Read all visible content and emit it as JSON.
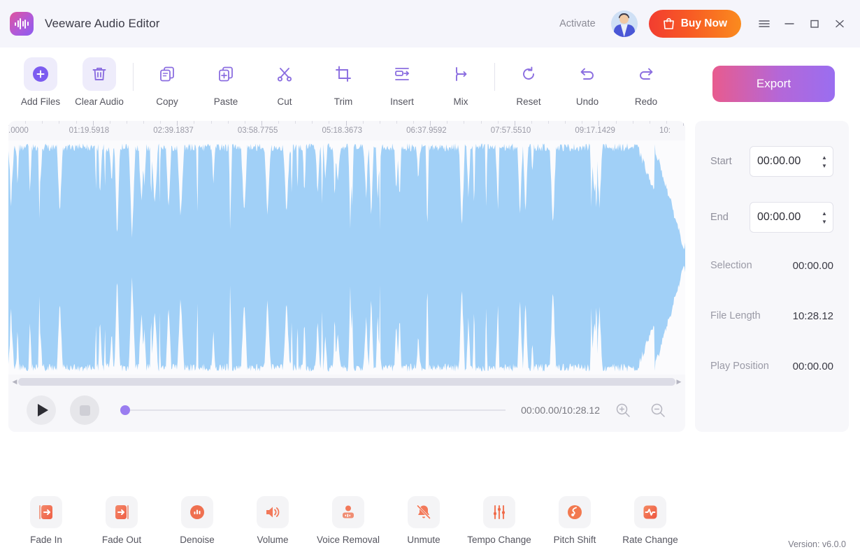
{
  "window": {
    "app_title": "Veeware Audio Editor",
    "logo_icon": "waveform-logo-icon",
    "activate_label": "Activate",
    "avatar_icon": "user-avatar",
    "buy_now_label": "Buy Now",
    "buy_now_icon": "shopping-bag-icon",
    "menu_icon": "hamburger-menu-icon",
    "minimize_icon": "minimize-icon",
    "maximize_icon": "maximize-icon",
    "close_icon": "close-icon",
    "titlebar_bg": "#f5f5fb",
    "buy_now_gradient": [
      "#f23d30",
      "#fa8b1e"
    ]
  },
  "toolbar": {
    "items": [
      {
        "label": "Add Files",
        "icon": "plus-circle-icon",
        "highlighted": true
      },
      {
        "label": "Clear Audio",
        "icon": "trash-icon",
        "highlighted": true
      },
      {
        "label": "Copy",
        "icon": "copy-icon",
        "highlighted": false
      },
      {
        "label": "Paste",
        "icon": "paste-icon",
        "highlighted": false
      },
      {
        "label": "Cut",
        "icon": "scissors-icon",
        "highlighted": false
      },
      {
        "label": "Trim",
        "icon": "crop-icon",
        "highlighted": false
      },
      {
        "label": "Insert",
        "icon": "insert-icon",
        "highlighted": false
      },
      {
        "label": "Mix",
        "icon": "mix-icon",
        "highlighted": false
      },
      {
        "label": "Reset",
        "icon": "reset-icon",
        "highlighted": false
      },
      {
        "label": "Undo",
        "icon": "undo-icon",
        "highlighted": false
      },
      {
        "label": "Redo",
        "icon": "redo-icon",
        "highlighted": false
      }
    ],
    "export_label": "Export",
    "export_gradient": [
      "#e85b8e",
      "#9a6ef0"
    ],
    "icon_color": "#8b6ee0"
  },
  "timeline": {
    "tick_labels": [
      ".0000",
      "01:19.5918",
      "02:39.1837",
      "03:58.7755",
      "05:18.3673",
      "06:37.9592",
      "07:57.5510",
      "09:17.1429",
      "10:"
    ],
    "waveform_color": "#a1d0f7",
    "scrollbar_left_icon": "scroll-left-arrow-icon",
    "scrollbar_right_icon": "scroll-right-arrow-icon"
  },
  "transport": {
    "play_icon": "play-icon",
    "stop_icon": "stop-icon",
    "seek_value_percent": 0,
    "time_display": "00:00.00/10:28.12",
    "zoom_in_icon": "zoom-in-icon",
    "zoom_out_icon": "zoom-out-icon"
  },
  "side_panel": {
    "start": {
      "label": "Start",
      "value": "00:00.00"
    },
    "end": {
      "label": "End",
      "value": "00:00.00"
    },
    "info": [
      {
        "label": "Selection",
        "value": "00:00.00"
      },
      {
        "label": "File Length",
        "value": "10:28.12"
      },
      {
        "label": "Play Position",
        "value": "00:00.00"
      }
    ]
  },
  "effects": [
    {
      "label": "Fade In",
      "icon": "fade-in-icon"
    },
    {
      "label": "Fade Out",
      "icon": "fade-out-icon"
    },
    {
      "label": "Denoise",
      "icon": "denoise-icon"
    },
    {
      "label": "Volume",
      "icon": "volume-icon"
    },
    {
      "label": "Voice Removal",
      "icon": "voice-removal-icon"
    },
    {
      "label": "Unmute",
      "icon": "bell-muted-icon"
    },
    {
      "label": "Tempo Change",
      "icon": "sliders-icon"
    },
    {
      "label": "Pitch Shift",
      "icon": "music-note-icon"
    },
    {
      "label": "Rate Change",
      "icon": "pulse-icon"
    }
  ],
  "footer": {
    "version": "Version: v6.0.0"
  }
}
